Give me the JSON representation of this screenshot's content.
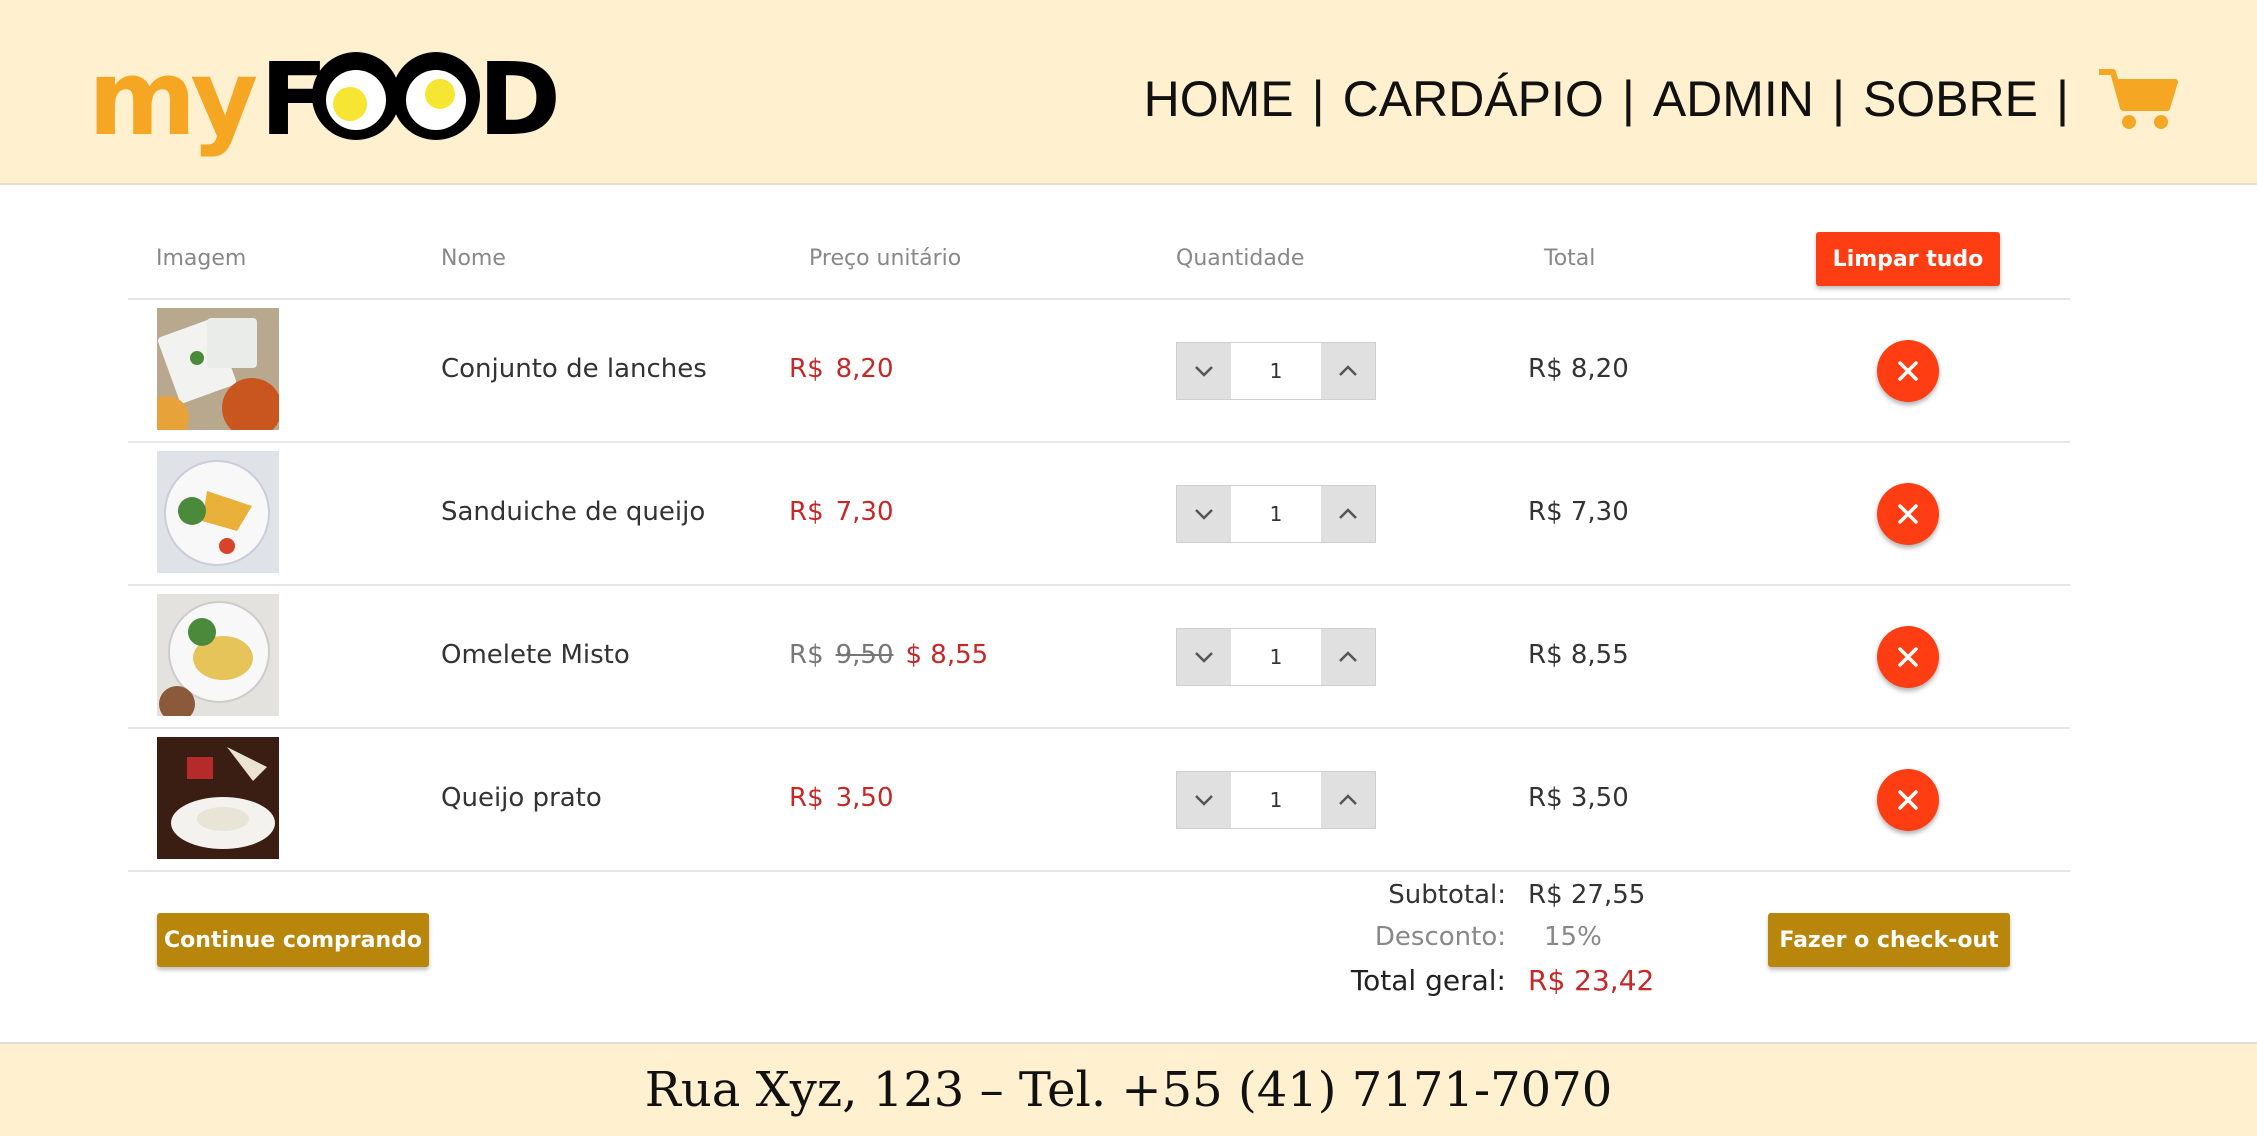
{
  "header": {
    "logo_text": "myFOOD",
    "nav": [
      {
        "label": "HOME"
      },
      {
        "label": "CARDÁPIO"
      },
      {
        "label": "ADMIN"
      },
      {
        "label": "SOBRE"
      }
    ],
    "cart_icon": "shopping-cart-icon"
  },
  "table": {
    "headers": {
      "image": "Imagem",
      "name": "Nome",
      "unit_price": "Preço unitário",
      "quantity": "Quantidade",
      "total": "Total"
    },
    "clear_all_label": "Limpar tudo",
    "rows": [
      {
        "name": "Conjunto de lanches",
        "currency": "R$",
        "price": "8,20",
        "quantity": "1",
        "total": "R$ 8,20"
      },
      {
        "name": "Sanduiche de queijo",
        "currency": "R$",
        "price": "7,30",
        "quantity": "1",
        "total": "R$ 7,30"
      },
      {
        "name": "Omelete Misto",
        "currency": "R$",
        "old_price": "9,50",
        "price": "$ 8,55",
        "quantity": "1",
        "total": "R$ 8,55"
      },
      {
        "name": "Queijo prato",
        "currency": "R$",
        "price": "3,50",
        "quantity": "1",
        "total": "R$ 3,50"
      }
    ]
  },
  "summary": {
    "subtotal_label": "Subtotal:",
    "subtotal_value": "R$ 27,55",
    "discount_label": "Desconto:",
    "discount_value": "15%",
    "grand_total_label": "Total geral:",
    "grand_total_value": "R$ 23,42"
  },
  "actions": {
    "continue_label": "Continue comprando",
    "checkout_label": "Fazer o check-out"
  },
  "footer": {
    "address": "Rua Xyz, 123 – Tel. +55 (41) 7171-7070"
  },
  "colors": {
    "header_bg": "#fff1d0",
    "accent_red": "#ff3d12",
    "accent_gold": "#b8860b",
    "logo_orange": "#f5a623",
    "logo_yellow": "#f6e633",
    "price_red": "#c62828"
  }
}
